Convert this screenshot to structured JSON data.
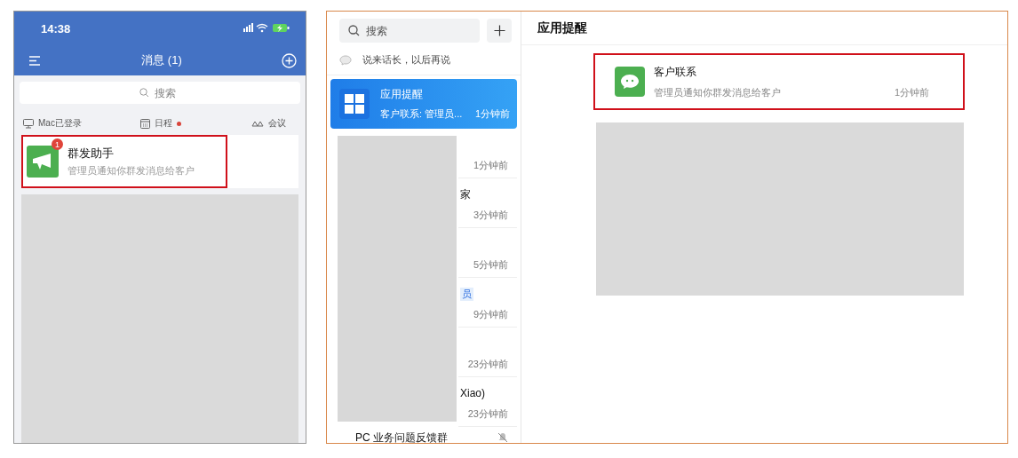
{
  "phone": {
    "status_bar": {
      "time": "14:38"
    },
    "nav": {
      "title": "消息 (1)"
    },
    "search": {
      "placeholder": "搜索"
    },
    "shortcuts": [
      {
        "label": "Mac已登录",
        "kind": "device",
        "dot": false
      },
      {
        "label": "日程",
        "kind": "calendar",
        "dot": true
      },
      {
        "label": "会议",
        "kind": "meeting",
        "dot": false
      }
    ],
    "chat": {
      "name": "群发助手",
      "preview": "管理员通知你群发消息给客户",
      "badge": "1",
      "highlighted": true
    }
  },
  "desktop": {
    "search": {
      "placeholder": "搜索"
    },
    "status": "说来话长，以后再说",
    "conversations": [
      {
        "name": "应用提醒",
        "preview": "客户联系: 管理员...",
        "time": "1分钟前",
        "selected": true,
        "muted": false
      },
      {
        "time": "1分钟前",
        "selected": false,
        "muted": false
      },
      {
        "name_visible": "家",
        "time": "3分钟前",
        "selected": false,
        "muted": false
      },
      {
        "time": "5分钟前",
        "selected": false,
        "muted": false
      },
      {
        "tag_visible": "员",
        "time": "9分钟前",
        "selected": false,
        "muted": false
      },
      {
        "time": "23分钟前",
        "selected": false,
        "muted": false
      },
      {
        "name_visible": "Xiao)",
        "time": "23分钟前",
        "selected": false,
        "muted": false
      },
      {
        "name_visible": "PC 业务问题反馈群",
        "selected": false,
        "muted": true
      }
    ],
    "panel": {
      "title": "应用提醒",
      "card": {
        "name": "客户联系",
        "preview": "管理员通知你群发消息给客户",
        "time": "1分钟前",
        "highlighted": true
      }
    }
  }
}
